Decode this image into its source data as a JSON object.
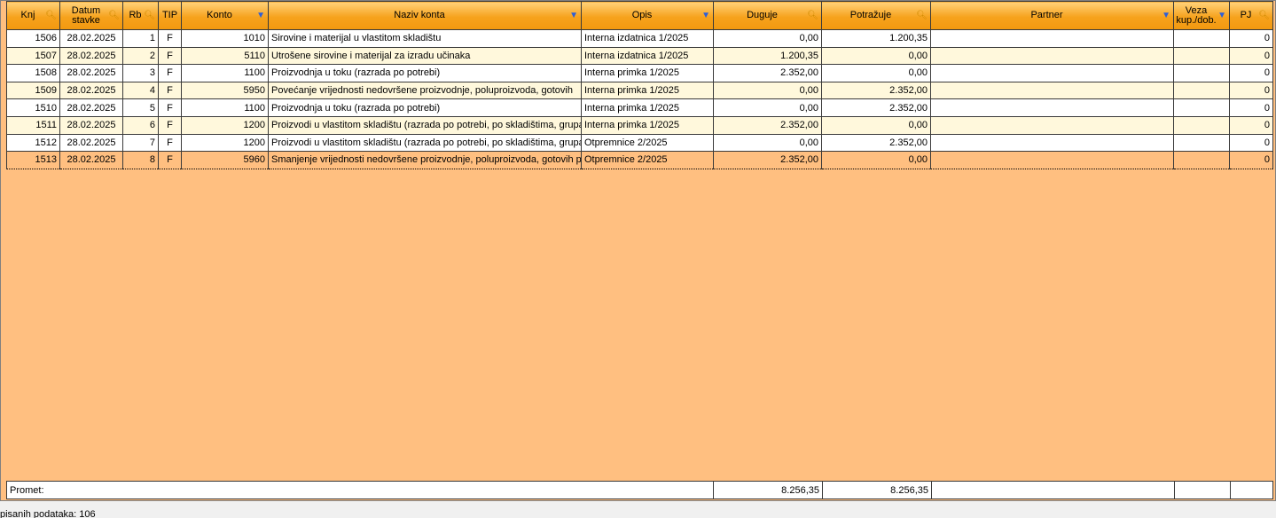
{
  "headers": {
    "knj": "Knj",
    "datum_line1": "Datum",
    "datum_line2": "stavke",
    "rb": "Rb",
    "tip": "TIP",
    "konto": "Konto",
    "naziv": "Naziv konta",
    "opis": "Opis",
    "duguje": "Duguje",
    "potrazuje": "Potražuje",
    "partner": "Partner",
    "veza_line1": "Veza",
    "veza_line2": "kup./dob.",
    "pj": "PJ"
  },
  "rows": [
    {
      "knj": "1506",
      "datum": "28.02.2025",
      "rb": "1",
      "tip": "F",
      "konto": "1010",
      "naziv": "Sirovine i materijal u vlastitom skladištu",
      "opis": "Interna izdatnica 1/2025",
      "duguje": "0,00",
      "potrazuje": "1.200,35",
      "partner": "",
      "veza": "",
      "pj": "0"
    },
    {
      "knj": "1507",
      "datum": "28.02.2025",
      "rb": "2",
      "tip": "F",
      "konto": "5110",
      "naziv": "Utrošene sirovine i materijal za izradu učinaka",
      "opis": "Interna izdatnica 1/2025",
      "duguje": "1.200,35",
      "potrazuje": "0,00",
      "partner": "",
      "veza": "",
      "pj": "0"
    },
    {
      "knj": "1508",
      "datum": "28.02.2025",
      "rb": "3",
      "tip": "F",
      "konto": "1100",
      "naziv": "Proizvodnja u toku (razrada po potrebi)",
      "opis": "Interna primka 1/2025",
      "duguje": "2.352,00",
      "potrazuje": "0,00",
      "partner": "",
      "veza": "",
      "pj": "0"
    },
    {
      "knj": "1509",
      "datum": "28.02.2025",
      "rb": "4",
      "tip": "F",
      "konto": "5950",
      "naziv": "Povećanje vrijednosti nedovršene proizvodnje, poluproizvoda, gotovih",
      "opis": "Interna primka 1/2025",
      "duguje": "0,00",
      "potrazuje": "2.352,00",
      "partner": "",
      "veza": "",
      "pj": "0"
    },
    {
      "knj": "1510",
      "datum": "28.02.2025",
      "rb": "5",
      "tip": "F",
      "konto": "1100",
      "naziv": "Proizvodnja u toku (razrada po potrebi)",
      "opis": "Interna primka 1/2025",
      "duguje": "0,00",
      "potrazuje": "2.352,00",
      "partner": "",
      "veza": "",
      "pj": "0"
    },
    {
      "knj": "1511",
      "datum": "28.02.2025",
      "rb": "6",
      "tip": "F",
      "konto": "1200",
      "naziv": "Proizvodi u vlastitom skladištu (razrada po potrebi, po skladištima, grupa",
      "opis": "Interna primka 1/2025",
      "duguje": "2.352,00",
      "potrazuje": "0,00",
      "partner": "",
      "veza": "",
      "pj": "0"
    },
    {
      "knj": "1512",
      "datum": "28.02.2025",
      "rb": "7",
      "tip": "F",
      "konto": "1200",
      "naziv": "Proizvodi u vlastitom skladištu (razrada po potrebi, po skladištima, grupa",
      "opis": "Otpremnice 2/2025",
      "duguje": "0,00",
      "potrazuje": "2.352,00",
      "partner": "",
      "veza": "",
      "pj": "0"
    },
    {
      "knj": "1513",
      "datum": "28.02.2025",
      "rb": "8",
      "tip": "F",
      "konto": "5960",
      "naziv": "Smanjenje vrijednosti nedovršene proizvodnje, poluproizvoda, gotovih p",
      "opis": "Otpremnice 2/2025",
      "duguje": "2.352,00",
      "potrazuje": "0,00",
      "partner": "",
      "veza": "",
      "pj": "0"
    }
  ],
  "selected_row": 7,
  "footer": {
    "label": "Promet:",
    "duguje_total": "8.256,35",
    "potrazuje_total": "8.256,35"
  },
  "status": {
    "text": "pisanih podataka: 106"
  },
  "colors": {
    "grid_background": "#ffbf80",
    "header_gradient": "#f6a21c",
    "row_even": "#fff8dc"
  },
  "icons": {
    "sort": "key-icon",
    "filter": "filter-icon"
  }
}
